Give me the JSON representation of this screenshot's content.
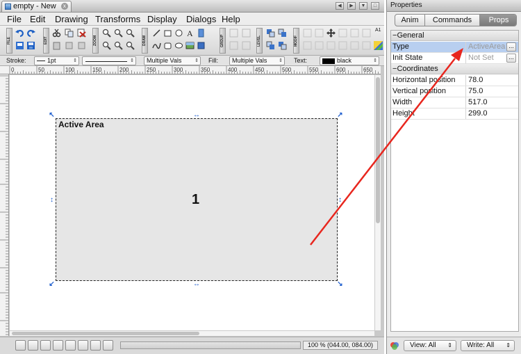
{
  "window": {
    "tab_title": "empty - New",
    "close_glyph": "x"
  },
  "menubar": [
    "File",
    "Edit",
    "Drawing",
    "Transforms",
    "Display",
    "Dialogs",
    "Help"
  ],
  "toolbar": {
    "group_labels": [
      "FILE",
      "EDIT",
      "ZOOM",
      "DRAW",
      "GROUP",
      "LEVEL",
      "MODIF"
    ],
    "a_label": "A1"
  },
  "stylebar": {
    "stroke_label": "Stroke:",
    "stroke_width": "1pt",
    "dash_value": "Multiple Vals",
    "fill_label": "Fill:",
    "fill_value": "Multiple Vals",
    "text_label": "Text:",
    "text_value": "black"
  },
  "ruler": {
    "h_marks": [
      "0",
      "50",
      "100",
      "150",
      "200",
      "250",
      "300",
      "350",
      "400",
      "450",
      "500",
      "550",
      "600",
      "650"
    ]
  },
  "canvas": {
    "area_title": "Active Area",
    "area_number": "1"
  },
  "statusbar": {
    "zoom_text": "100 % (044.00, 084.00)"
  },
  "properties": {
    "title": "Properties",
    "tabs": [
      "Anim",
      "Commands",
      "Props"
    ],
    "selected_tab": "Props",
    "sections": [
      {
        "name": "General",
        "rows": [
          {
            "key": "Type",
            "value": "ActiveArea"
          },
          {
            "key": "Init State",
            "value": "Not Set"
          }
        ]
      },
      {
        "name": "Coordinates",
        "rows": [
          {
            "key": "Horizontal position",
            "value": "78.0"
          },
          {
            "key": "Vertical position",
            "value": "75.0"
          },
          {
            "key": "Width",
            "value": "517.0"
          },
          {
            "key": "Height",
            "value": "299.0"
          }
        ]
      }
    ],
    "collapse_glyph": "−",
    "dots": "...",
    "view_combo": "View: All",
    "write_combo": "Write: All"
  },
  "colors": {
    "handle": "#1f5fcf",
    "annotation_arrow": "#e8261e",
    "selected_row": "#b8cff0",
    "active_area_fill": "#e6e6e6"
  },
  "icons": [
    "undo-icon",
    "redo-icon",
    "new-icon",
    "save-icon",
    "copy-icon",
    "paste-icon",
    "delete-icon",
    "zoom-in-icon",
    "zoom-out-icon",
    "line-icon",
    "rect-icon",
    "ellipse-icon",
    "text-icon",
    "image-icon",
    "group-icon",
    "level-up-icon",
    "level-down-icon",
    "move-icon",
    "color-icon"
  ]
}
